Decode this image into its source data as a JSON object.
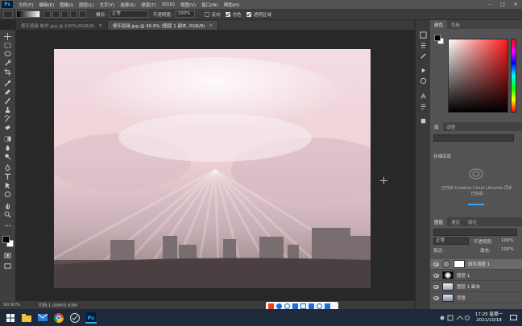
{
  "menubar": {
    "logo": "Ps",
    "items": [
      "文件(F)",
      "编辑(E)",
      "图像(I)",
      "图层(L)",
      "文字(Y)",
      "选择(S)",
      "滤镜(T)",
      "3D(D)",
      "视图(V)",
      "窗口(W)",
      "帮助(H)"
    ]
  },
  "options": {
    "mode_label": "模式:",
    "mode_value": "正常",
    "opacity_label": "不透明度:",
    "opacity_value": "100%",
    "reverse_label": "反向",
    "dither_label": "仿色",
    "transparency_label": "透明区域"
  },
  "tabs": [
    {
      "label": "视乐层级 制作.jpg @ 100%(RGB/8)"
    },
    {
      "label": "视乐层级.jpg @ 90.9% (图层 1 副本, RGB/8)"
    }
  ],
  "status": {
    "zoom": "90.91%",
    "doc": "文档:1.00M/5.93M"
  },
  "color_panel": {
    "tabs": [
      "颜色",
      "色板"
    ]
  },
  "library_panel": {
    "tabs": [
      "库",
      "调整"
    ],
    "search_placeholder": "",
    "library_name": "存储库库",
    "message_line1": "已开启 Creative Cloud Libraries 同步",
    "message_line2": "已完成"
  },
  "layers_panel": {
    "tabs": [
      "图层",
      "通道",
      "路径"
    ],
    "blend_mode": "正常",
    "opacity_label": "不透明度:",
    "opacity_value": "100%",
    "lock_label": "锁定:",
    "fill_label": "填充:",
    "fill_value": "100%",
    "layers": [
      {
        "name": "颜色调整 1"
      },
      {
        "name": "图层 1"
      },
      {
        "name": "图层 1 副本"
      },
      {
        "name": "背景"
      }
    ]
  },
  "taskbar": {
    "time": "17:25 星期一",
    "date": "2021/10/18"
  },
  "colors": {
    "menubar_bg": "#535353",
    "panel_bg": "#535353",
    "workspace_bg": "#282828",
    "taskbar_bg": "#1e2a3a",
    "accent": "#31a8ff"
  }
}
